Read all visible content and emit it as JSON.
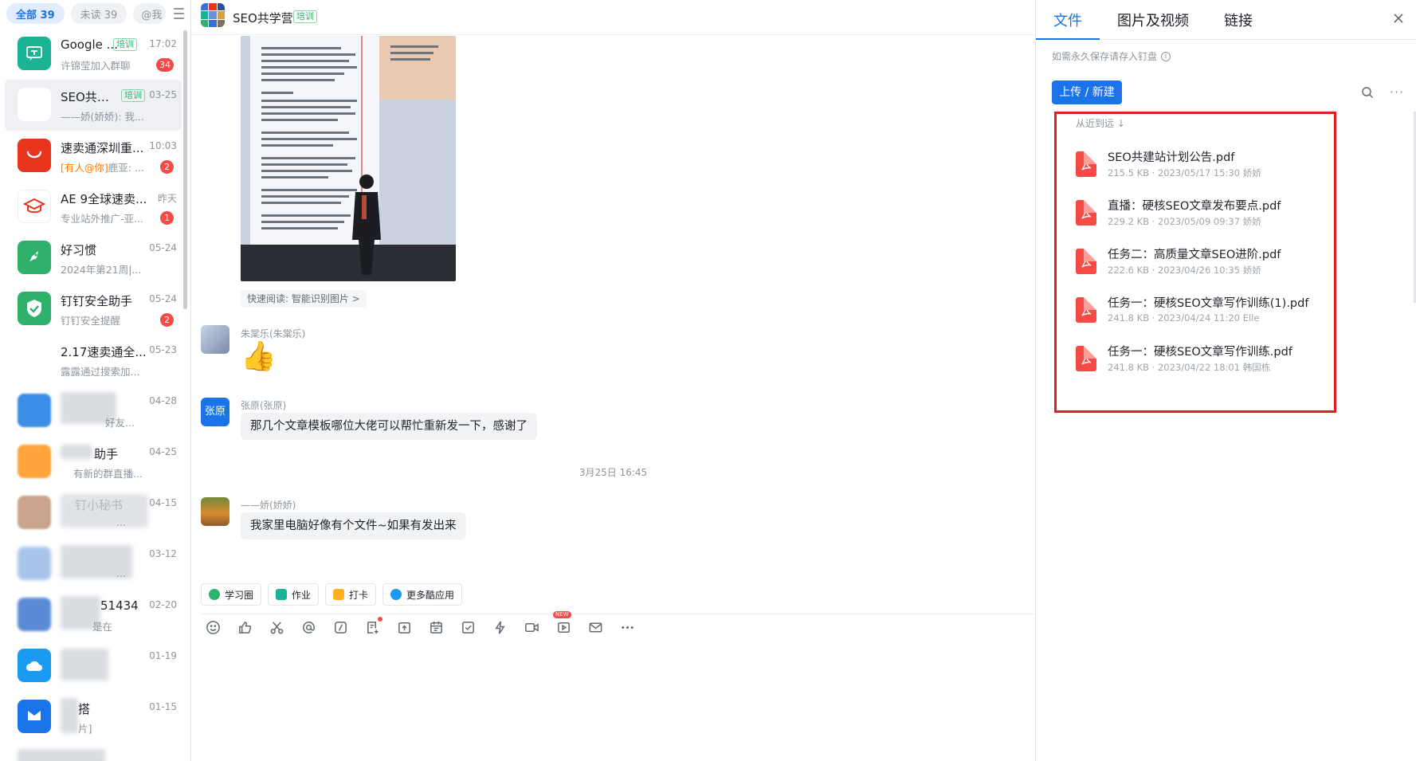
{
  "filters": {
    "all": "全部 39",
    "unread": "未读 39",
    "at": "@我"
  },
  "conversations": [
    {
      "name": "Google ...",
      "tag": "培训",
      "time": "17:02",
      "preview": "许锦莹加入群聊",
      "badge": "34",
      "avatar_color": "#1ab394"
    },
    {
      "name": "SEO共学营",
      "tag": "培训",
      "time": "03-25",
      "preview": "——娇(娇娇): 我...",
      "badge": "",
      "avatar_color": "#3b6fd6"
    },
    {
      "name": "速卖通深圳重...",
      "tag": "",
      "time": "10:03",
      "preview_at": "[有人@你]",
      "preview": "鹿亚: ...",
      "badge": "2",
      "avatar_color": "#e8341c"
    },
    {
      "name": "AE 9全球速卖...",
      "tag": "",
      "time": "昨天",
      "preview": "专业站外推广-亚...",
      "badge": "1",
      "avatar_color": "#ffffff"
    },
    {
      "name": "好习惯",
      "tag": "",
      "time": "05-24",
      "preview": "2024年第21周|...",
      "badge": "",
      "avatar_color": "#2fb16b"
    },
    {
      "name": "钉钉安全助手",
      "tag": "",
      "time": "05-24",
      "preview": "钉钉安全提醒",
      "badge": "2",
      "avatar_color": "#2fb16b"
    },
    {
      "name": "2.17速卖通全...",
      "tag": "",
      "time": "05-23",
      "preview": "露露通过搜索加...",
      "badge": "",
      "avatar_color": "#8a6d5c"
    },
    {
      "name": "好友",
      "tag": "",
      "time": "04-28",
      "preview": "好友...",
      "badge": "",
      "avatar_color": "#3a8ee6"
    },
    {
      "name": "助手",
      "tag": "",
      "time": "04-25",
      "preview": "有新的群直播...",
      "badge": "",
      "avatar_color": "#ffa53b"
    },
    {
      "name": "钉小秘书",
      "tag": "",
      "time": "04-15",
      "preview": "...",
      "badge": "",
      "avatar_color": "#c9a48a"
    },
    {
      "name": "",
      "tag": "",
      "time": "03-12",
      "preview": "...",
      "badge": "",
      "avatar_color": "#a8c4ea"
    },
    {
      "name": "51434",
      "tag": "",
      "time": "02-20",
      "preview": "是在",
      "badge": "",
      "avatar_color": "#5b8bd6"
    },
    {
      "name": "",
      "tag": "",
      "time": "01-19",
      "preview": "",
      "badge": "",
      "avatar_color": "#1a9af0"
    },
    {
      "name": "搭",
      "tag": "",
      "time": "01-15",
      "preview": "片]",
      "badge": "",
      "avatar_color": "#1a73e8"
    }
  ],
  "chat": {
    "title": "SEO共学营",
    "title_tag": "培训",
    "quick_read": "快速阅读: 智能识别图片 >",
    "messages": [
      {
        "sender": "朱棠乐(朱棠乐)",
        "text": "👍"
      },
      {
        "sender": "张原(张原)",
        "avatar_text": "张原",
        "text": "那几个文章模板哪位大佬可以帮忙重新发一下，感谢了"
      },
      {
        "sender": "——娇(娇娇)",
        "text": "我家里电脑好像有个文件~如果有发出来"
      }
    ],
    "timestamp": "3月25日 16:45",
    "apps": [
      "学习圈",
      "作业",
      "打卡",
      "更多酷应用"
    ],
    "new_label": "NEW"
  },
  "panel": {
    "tabs": [
      "文件",
      "图片及视频",
      "链接"
    ],
    "hint": "如需永久保存请存入钉盘",
    "upload": "上传 / 新建",
    "sort": "从近到远 ↓",
    "files": [
      {
        "name": "SEO共建站计划公告.pdf",
        "meta": "215.5 KB · 2023/05/17 15:30 娇娇"
      },
      {
        "name": "直播：硬核SEO文章发布要点.pdf",
        "meta": "229.2 KB · 2023/05/09 09:37 娇娇"
      },
      {
        "name": "任务二：高质量文章SEO进阶.pdf",
        "meta": "222.6 KB · 2023/04/26 10:35 娇娇"
      },
      {
        "name": "任务一：硬核SEO文章写作训练(1).pdf",
        "meta": "241.8 KB · 2023/04/24 11:20 Elle"
      },
      {
        "name": "任务一：硬核SEO文章写作训练.pdf",
        "meta": "241.8 KB · 2023/04/22 18:01 韩国栋"
      }
    ]
  }
}
